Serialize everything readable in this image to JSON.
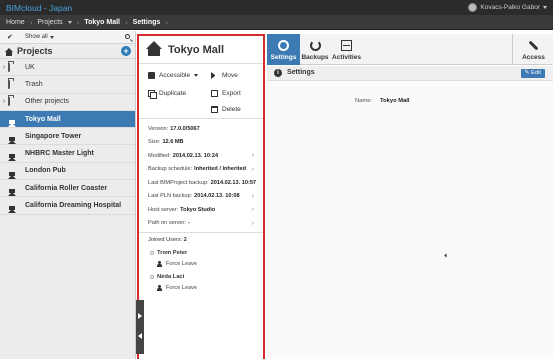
{
  "brand": "BIMcloud - Japan",
  "user": {
    "name": "Kovacs-Palko Gabor"
  },
  "breadcrumb": {
    "home": "Home",
    "projects": "Projects",
    "current": "Tokyo Mall",
    "page": "Settings"
  },
  "sidebar": {
    "check": "✔",
    "show_all": "Show all",
    "title": "Projects",
    "add": "+",
    "items": [
      {
        "label": "UK",
        "type": "folder"
      },
      {
        "label": "Trash",
        "type": "folder"
      },
      {
        "label": "Other projects",
        "type": "folder"
      },
      {
        "label": "Tokyo Mall",
        "type": "project"
      },
      {
        "label": "Singapore Tower",
        "type": "project"
      },
      {
        "label": "NHBRC Master Light",
        "type": "project"
      },
      {
        "label": "London Pub",
        "type": "project"
      },
      {
        "label": "California Roller Coaster",
        "type": "project"
      },
      {
        "label": "California Dreaming Hospital",
        "type": "project"
      }
    ]
  },
  "panel": {
    "title": "Tokyo Mall",
    "actions": {
      "accessible": "Accessible",
      "move": "Move",
      "duplicate": "Duplicate",
      "export": "Export",
      "delete": "Delete"
    },
    "props": [
      {
        "label": "Version:",
        "value": "17.0.0/5067"
      },
      {
        "label": "Size:",
        "value": "12.6 MB"
      },
      {
        "label": "Modified:",
        "value": "2014.02.13. 10:24"
      },
      {
        "label": "Backup schedule:",
        "value": "Inherited / Inherited"
      },
      {
        "label": "Last BIMProject backup:",
        "value": "2014.02.13. 10:57"
      },
      {
        "label": "Last PLN backup:",
        "value": "2014.02.13. 10:08"
      },
      {
        "label": "Host server:",
        "value": "Tokyo Studio"
      },
      {
        "label": "Path on server:",
        "value": "-"
      }
    ],
    "joined_label": "Joined Users:",
    "joined_count": "2",
    "users": [
      {
        "name": "Trom Peter",
        "action": "Force Leave"
      },
      {
        "name": "Néda Laci",
        "action": "Force Leave"
      }
    ]
  },
  "tabs": {
    "settings": "Settings",
    "backups": "Backups",
    "activities": "Activities",
    "access": "Access"
  },
  "settings": {
    "title": "Settings",
    "edit": "✎ Edit",
    "name_label": "Name:",
    "name_value": "Tokyo Mall"
  },
  "colors": {
    "accent": "#3d7ab3",
    "highlight_border": "#d42c2c",
    "topbar": "#2b2b2b",
    "brand": "#4aa3df"
  }
}
